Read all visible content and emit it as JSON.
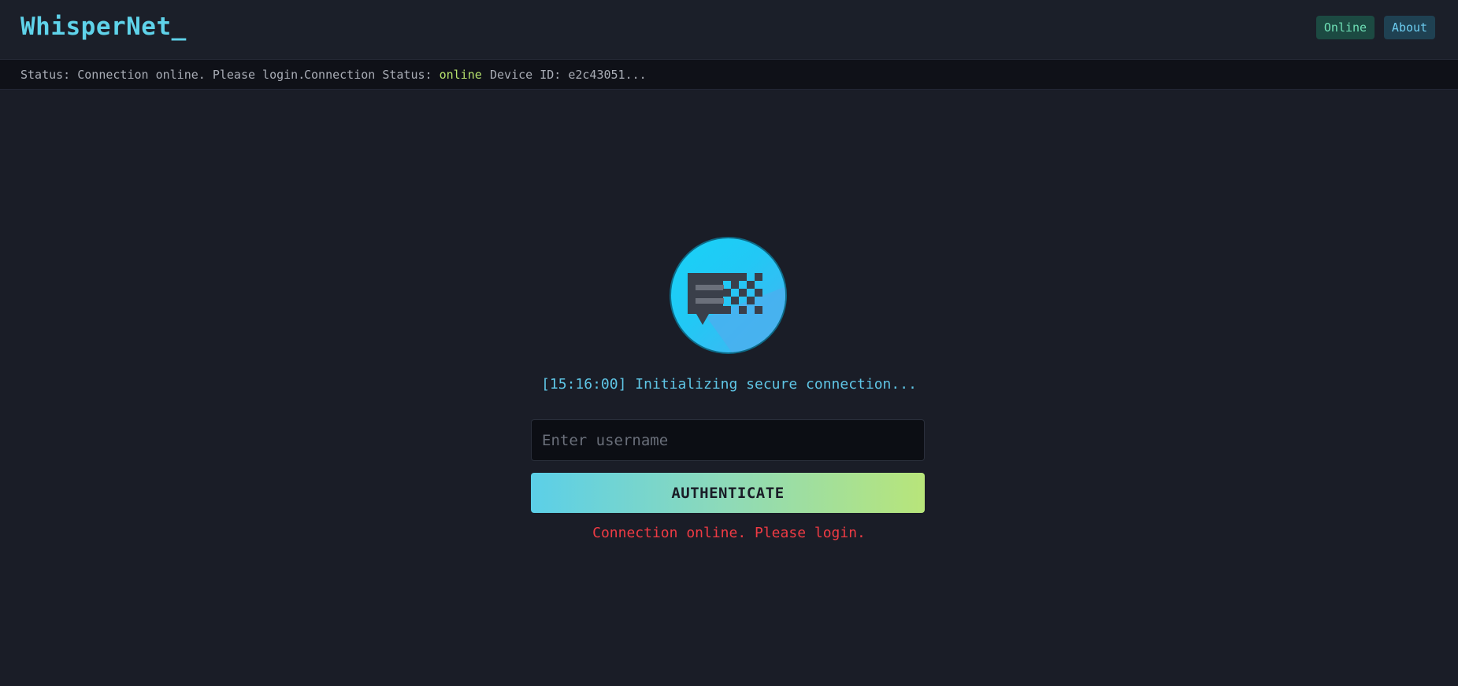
{
  "header": {
    "logo_text": "WhisperNet_",
    "online_button": "Online",
    "about_button": "About"
  },
  "statusbar": {
    "status_text": "Status: Connection online. Please login.",
    "connection_label": "Connection Status: ",
    "connection_value": "online",
    "device_id": "Device ID: e2c43051..."
  },
  "main": {
    "logo_icon": "chat-bubble-pixel-icon",
    "log_line": "[15:16:00] Initializing secure connection...",
    "username_placeholder": "Enter username",
    "username_value": "",
    "auth_button": "AUTHENTICATE",
    "error_message": "Connection online. Please login."
  },
  "colors": {
    "accent": "#5fd3ea",
    "online_green": "#b6e26c",
    "error_red": "#ef3b44",
    "background": "#1a1d27"
  }
}
